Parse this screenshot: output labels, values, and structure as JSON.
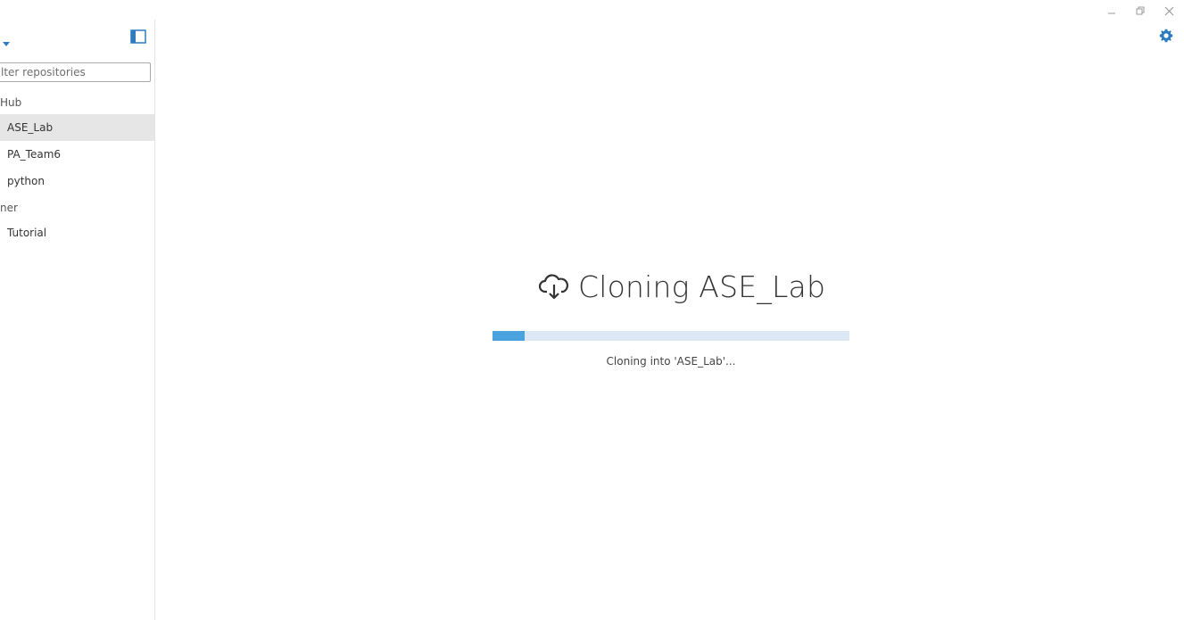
{
  "window": {
    "controls": {
      "minimize_icon": "minimize-icon",
      "restore_icon": "restore-icon",
      "close_icon": "close-icon"
    },
    "settings_icon": "gear-icon"
  },
  "sidebar": {
    "account_dropdown_icon": "caret-down-icon",
    "toggle_icon": "sidebar-toggle-icon",
    "filter": {
      "placeholder": "lter repositories",
      "value": ""
    },
    "groups": [
      {
        "label": "Hub",
        "items": [
          {
            "label": "ASE_Lab",
            "selected": true
          },
          {
            "label": "PA_Team6",
            "selected": false
          },
          {
            "label": "python",
            "selected": false
          }
        ]
      },
      {
        "label": "ner",
        "items": [
          {
            "label": "Tutorial",
            "selected": false
          }
        ]
      }
    ]
  },
  "main": {
    "title_icon": "cloud-download-icon",
    "title": "Cloning ASE_Lab",
    "progress": {
      "fraction": 0.09,
      "color": "#4aa3df",
      "track_color": "#dce8f3"
    },
    "status": "Cloning into 'ASE_Lab'..."
  },
  "colors": {
    "accent": "#2f7bbf",
    "selected_row": "#e6e6e6"
  }
}
